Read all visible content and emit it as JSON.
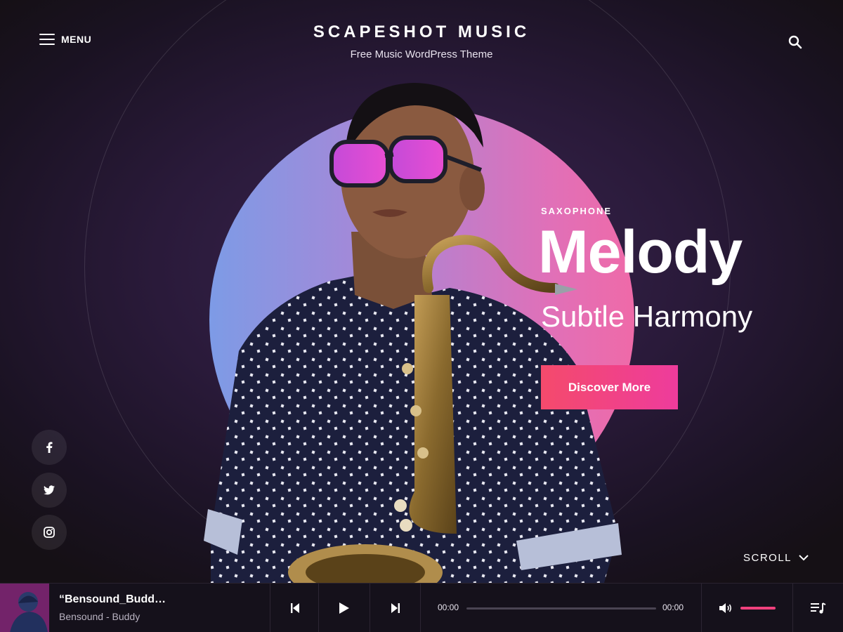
{
  "header": {
    "menu_label": "MENU",
    "site_title": "SCAPESHOT MUSIC",
    "site_tagline": "Free Music WordPress Theme"
  },
  "hero": {
    "subtitle": "SAXOPHONE",
    "title": "Melody",
    "tagline": "Subtle Harmony",
    "cta_label": "Discover More"
  },
  "social": [
    {
      "network": "facebook",
      "icon": "facebook-icon"
    },
    {
      "network": "twitter",
      "icon": "twitter-icon"
    },
    {
      "network": "instagram",
      "icon": "instagram-icon"
    }
  ],
  "scroll_label": "SCROLL",
  "player": {
    "track_title": "“Bensound_Budd…",
    "track_artist": "Bensound - Buddy",
    "current_time": "00:00",
    "total_time": "00:00",
    "progress_fraction": 0,
    "volume_fraction": 1.0
  },
  "colors": {
    "accent": "#f0417d",
    "cta_gradient_start": "#f44a6c",
    "cta_gradient_end": "#ee3c9c",
    "circle_gradient_start": "#7d9be6",
    "circle_gradient_end": "#ef6aa8",
    "background": "#2a1a3a"
  }
}
